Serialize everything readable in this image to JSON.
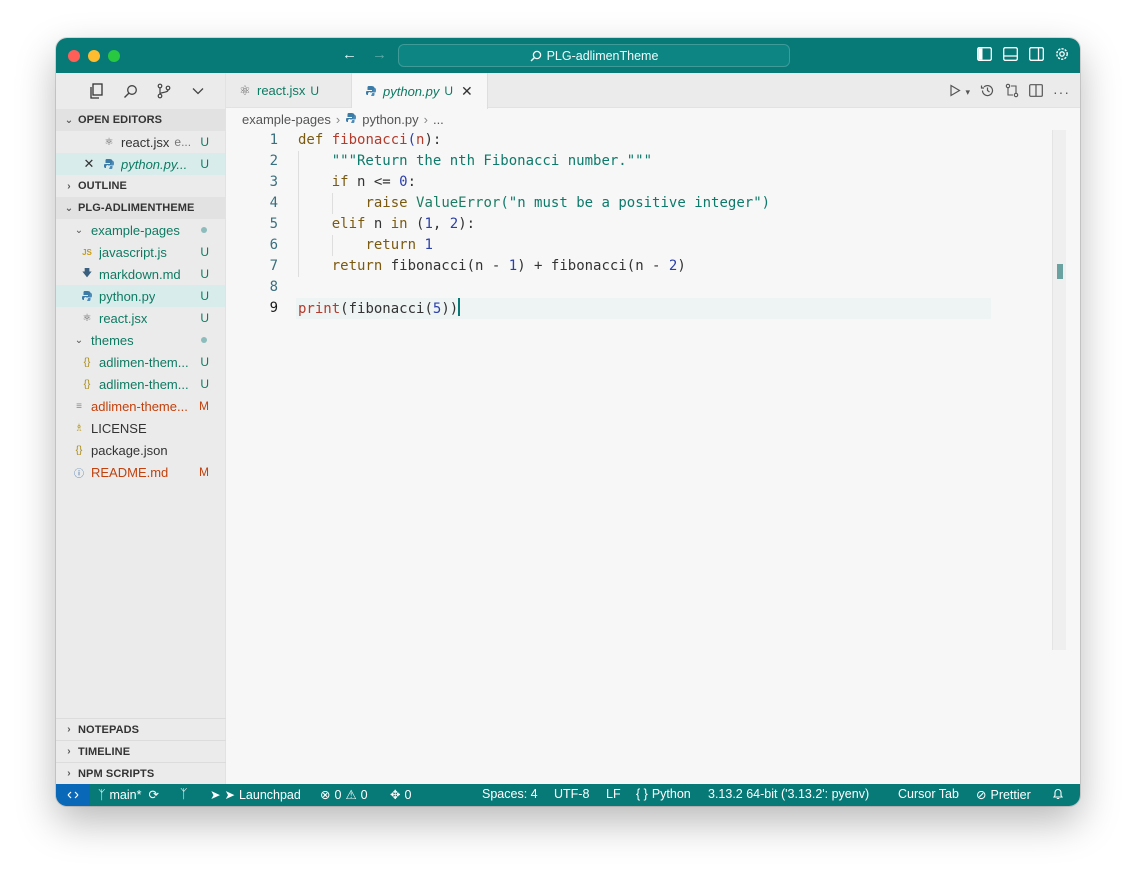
{
  "window": {
    "title": "PLG-adlimenTheme"
  },
  "colors": {
    "titlebar": "#077a78",
    "statusbar": "#077a78",
    "remote": "#0a68b8",
    "untracked": "#0f7a62",
    "modified": "#c2410c"
  },
  "sidebar": {
    "open_editors": {
      "header": "OPEN EDITORS",
      "items": [
        {
          "name": "react.jsx",
          "hint": "e...",
          "badge": "U"
        },
        {
          "name": "python.py...",
          "badge": "U"
        }
      ]
    },
    "outline_header": "OUTLINE",
    "project_header": "PLG-ADLIMENTHEME",
    "tree": [
      {
        "label": "example-pages",
        "type": "folder"
      },
      {
        "label": "javascript.js",
        "badge": "U",
        "icon": "js-icon"
      },
      {
        "label": "markdown.md",
        "badge": "U",
        "icon": "markdown-icon"
      },
      {
        "label": "python.py",
        "badge": "U",
        "icon": "python-icon"
      },
      {
        "label": "react.jsx",
        "badge": "U",
        "icon": "react-icon"
      },
      {
        "label": "themes",
        "type": "folder"
      },
      {
        "label": "adlimen-them...",
        "badge": "U",
        "icon": "json-icon"
      },
      {
        "label": "adlimen-them...",
        "badge": "U",
        "icon": "json-icon"
      },
      {
        "label": "adlimen-theme...",
        "badge": "M",
        "icon": "text-icon"
      },
      {
        "label": "LICENSE",
        "icon": "license-icon"
      },
      {
        "label": "package.json",
        "icon": "json-icon"
      },
      {
        "label": "README.md",
        "badge": "M",
        "icon": "info-icon"
      }
    ],
    "bottom": [
      "NOTEPADS",
      "TIMELINE",
      "NPM SCRIPTS"
    ]
  },
  "tabs": [
    {
      "label": "react.jsx",
      "badge": "U"
    },
    {
      "label": "python.py",
      "badge": "U"
    }
  ],
  "breadcrumb": {
    "folder": "example-pages",
    "file": "python.py",
    "more": "..."
  },
  "editor": {
    "line_numbers": [
      "1",
      "2",
      "3",
      "4",
      "5",
      "6",
      "7",
      "8",
      "9"
    ],
    "code": {
      "l1": {
        "kw": "def",
        "fn": "fibonacci",
        "p1": "(",
        "arg": "n",
        "p2": "):"
      },
      "l2": {
        "str": "\"\"\"Return the nth Fibonacci number.\"\"\""
      },
      "l3": {
        "kw": "if",
        "rest": " n <= ",
        "num": "0",
        "end": ":"
      },
      "l4": {
        "kw": "raise",
        "cls": "ValueError",
        "p1": "(",
        "str": "\"n must be a positive integer\"",
        "p2": ")"
      },
      "l5": {
        "kw": "elif",
        "rest": " n ",
        "kw2": "in",
        "p1": " (",
        "n1": "1",
        "c": ", ",
        "n2": "2",
        "p2": "):"
      },
      "l6": {
        "kw": "return",
        "num": "1"
      },
      "l7": {
        "kw": "return",
        "a": " fibonacci(n ",
        "op": "-",
        "n1": "1",
        "b": ") + fibonacci(n ",
        "op2": "-",
        "n2": "2",
        "c": ")"
      },
      "l9": {
        "fn": "print",
        "a": "(fibonacci(",
        "num": "5",
        "b": "))"
      }
    }
  },
  "statusbar": {
    "branch": "main*",
    "launchpad": "Launchpad",
    "errors": "0",
    "warnings": "0",
    "ports": "0",
    "spaces": "Spaces: 4",
    "encoding": "UTF-8",
    "eol": "LF",
    "language": "Python",
    "interpreter": "3.13.2 64-bit ('3.13.2': pyenv)",
    "cursor_tab": "Cursor Tab",
    "prettier": "Prettier"
  }
}
